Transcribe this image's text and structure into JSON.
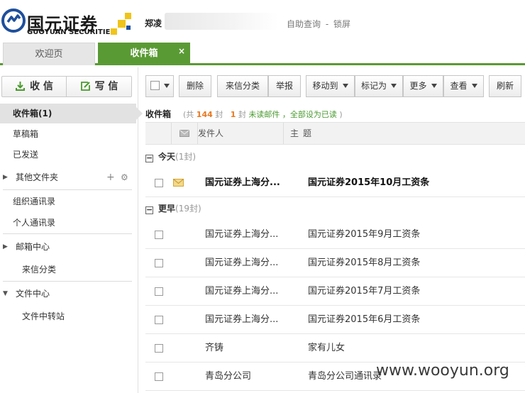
{
  "brand": {
    "name_cn": "国元证券",
    "name_en": "GUOYUAN SECURITIES",
    "accent": "#5a9a34"
  },
  "header": {
    "username": "郑凌",
    "link_selfquery": "自助查询",
    "link_sep": "-",
    "link_lock": "锁屏"
  },
  "tabs": [
    {
      "label": "欢迎页"
    },
    {
      "label": "收件箱",
      "close": "×"
    }
  ],
  "sidebar": {
    "receive_label": "收 信",
    "write_label": "写 信",
    "items": [
      {
        "label": "收件箱(1)"
      },
      {
        "label": "草稿箱"
      },
      {
        "label": "已发送"
      },
      {
        "label": "其他文件夹"
      },
      {
        "label": "组织通讯录"
      },
      {
        "label": "个人通讯录"
      },
      {
        "label": "邮箱中心"
      },
      {
        "label": "来信分类"
      },
      {
        "label": "文件中心"
      },
      {
        "label": "文件中转站"
      }
    ]
  },
  "toolbar": {
    "delete": "删除",
    "classify": "来信分类",
    "report": "举报",
    "move_to": "移动到",
    "mark_as": "标记为",
    "more": "更多",
    "view": "查看",
    "refresh": "刷新"
  },
  "inbox": {
    "title": "收件箱",
    "stats_prefix": "(共",
    "total": "144",
    "stats_mid": "封",
    "unread_count": "1",
    "unread_suffix": "封",
    "unread_label": "未读邮件",
    "mark_all_read": "，全部设为已读",
    "stats_end": ")"
  },
  "list": {
    "col_sender": "发件人",
    "col_subject": "主题",
    "groups": [
      {
        "label": "今天",
        "count": "(1封)"
      },
      {
        "label": "更早",
        "count": "(19封)"
      }
    ],
    "rows": [
      {
        "sender": "国元证券上海分...",
        "subject": "国元证券2015年10月工资条"
      },
      {
        "sender": "国元证券上海分...",
        "subject": "国元证券2015年9月工资条"
      },
      {
        "sender": "国元证券上海分...",
        "subject": "国元证券2015年8月工资条"
      },
      {
        "sender": "国元证券上海分...",
        "subject": "国元证券2015年7月工资条"
      },
      {
        "sender": "国元证券上海分...",
        "subject": "国元证券2015年6月工资条"
      },
      {
        "sender": "齐铸",
        "subject": "家有儿女"
      },
      {
        "sender": "青岛分公司",
        "subject": "青岛分公司通讯录"
      }
    ]
  },
  "watermark": "www.wooyun.org"
}
